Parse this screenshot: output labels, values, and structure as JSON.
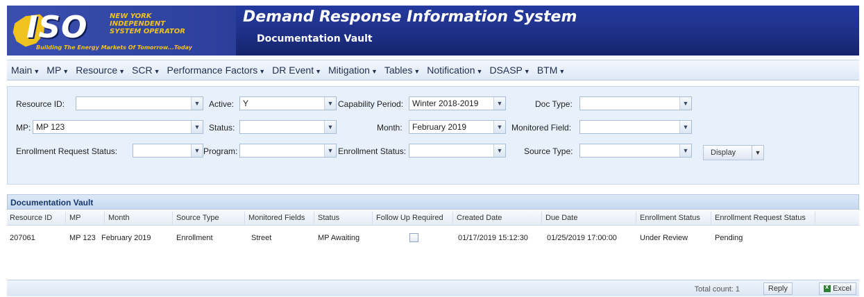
{
  "header": {
    "logo_text": "ISO",
    "logo_org": "NEW YORK INDEPENDENT SYSTEM OPERATOR",
    "logo_tagline": "Building The Energy Markets Of Tomorrow...Today",
    "title": "Demand Response Information System",
    "subtitle": "Documentation Vault"
  },
  "menu": [
    {
      "label": "Main"
    },
    {
      "label": "MP"
    },
    {
      "label": "Resource"
    },
    {
      "label": "SCR"
    },
    {
      "label": "Performance Factors"
    },
    {
      "label": "DR Event"
    },
    {
      "label": "Mitigation"
    },
    {
      "label": "Tables"
    },
    {
      "label": "Notification"
    },
    {
      "label": "DSASP"
    },
    {
      "label": "BTM"
    }
  ],
  "filters": {
    "resource_id": {
      "label": "Resource ID:",
      "value": ""
    },
    "active": {
      "label": "Active:",
      "value": "Y"
    },
    "capability_period": {
      "label": "Capability Period:",
      "value": "Winter 2018-2019"
    },
    "doc_type": {
      "label": "Doc Type:",
      "value": ""
    },
    "mp": {
      "label": "MP:",
      "value": "MP 123"
    },
    "status": {
      "label": "Status:",
      "value": ""
    },
    "month": {
      "label": "Month:",
      "value": "February 2019"
    },
    "monitored_field": {
      "label": "Monitored Field:",
      "value": ""
    },
    "enrollment_request_status": {
      "label": "Enrollment Request Status:",
      "value": ""
    },
    "program": {
      "label": "Program:",
      "value": ""
    },
    "enrollment_status": {
      "label": "Enrollment Status:",
      "value": ""
    },
    "source_type": {
      "label": "Source Type:",
      "value": ""
    },
    "display_button": "Display"
  },
  "grid": {
    "title": "Documentation Vault",
    "columns": [
      "Resource ID",
      "MP",
      "Month",
      "Source Type",
      "Monitored Fields",
      "Status",
      "Follow Up Required",
      "Created Date",
      "Due Date",
      "Enrollment Status",
      "Enrollment Request Status"
    ],
    "rows": [
      {
        "resource_id": "207061",
        "mp": "MP 123",
        "month": "February 2019",
        "source_type": "Enrollment",
        "monitored_fields": "Street",
        "status": "MP Awaiting",
        "follow_up_required": false,
        "created_date": "01/17/2019 15:12:30",
        "due_date": "01/25/2019 17:00:00",
        "enrollment_status": "Under Review",
        "enrollment_request_status": "Pending"
      }
    ],
    "total_count": "Total count: 1",
    "reply_label": "Reply",
    "excel_label": "Excel"
  }
}
